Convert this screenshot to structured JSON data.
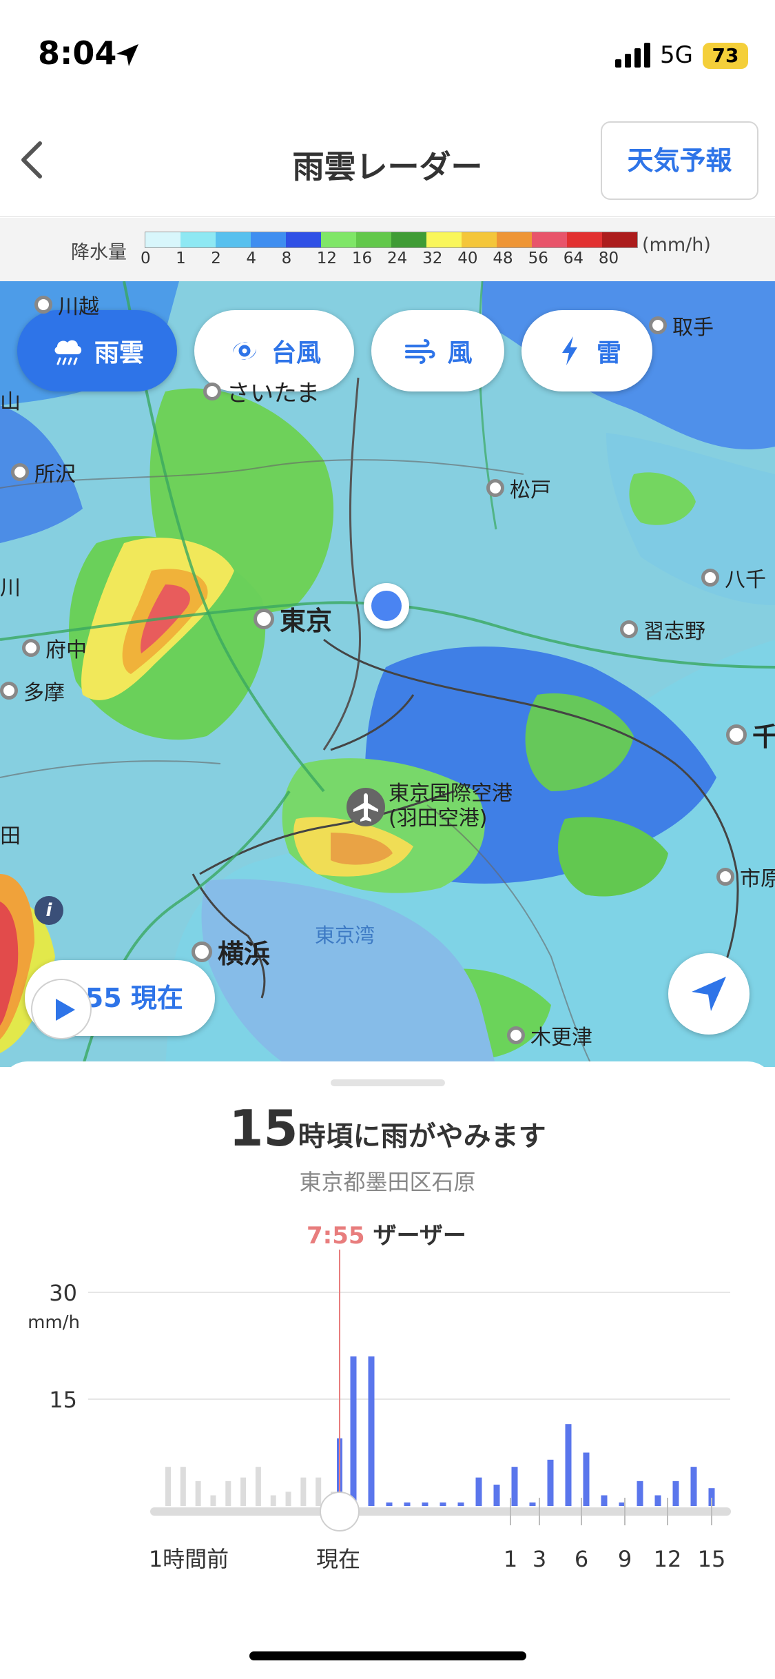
{
  "status": {
    "time": "8:04",
    "network": "5G",
    "battery": "73"
  },
  "nav": {
    "title": "雨雲レーダー",
    "forecast_button": "天気予報"
  },
  "legend": {
    "title": "降水量",
    "unit": "(mm/h)",
    "ticks": [
      "0",
      "1",
      "2",
      "4",
      "8",
      "12",
      "16",
      "24",
      "32",
      "40",
      "48",
      "56",
      "64",
      "80"
    ],
    "colors": [
      "#d8f6fb",
      "#8ee8f3",
      "#57c0ee",
      "#3f8ef0",
      "#2f50e6",
      "#7fe667",
      "#62c84a",
      "#3f9c35",
      "#f9f65a",
      "#f4c63a",
      "#ee9535",
      "#e8546a",
      "#e23030",
      "#ac1c1c"
    ]
  },
  "layers": [
    {
      "label": "雨雲",
      "icon": "rain-cloud-icon",
      "active": true
    },
    {
      "label": "台風",
      "icon": "typhoon-icon",
      "active": false
    },
    {
      "label": "風",
      "icon": "wind-icon",
      "active": false
    },
    {
      "label": "雷",
      "icon": "lightning-icon",
      "active": false
    }
  ],
  "map": {
    "places": {
      "kawagoe": "川越",
      "toride": "取手",
      "saitama": "さいたま",
      "tokorozawa": "所沢",
      "matsudo": "松戸",
      "yachiyo": "八千",
      "narashino": "習志野",
      "tokyo": "東京",
      "fuchu": "府中",
      "tama": "多摩",
      "chiba": "千",
      "airport": "東京国際空港\n(羽田空港)",
      "ichihara": "市原",
      "yokohama": "横浜",
      "kisarazu": "木更津",
      "bay": "東京湾",
      "edge_yama": "山",
      "edge_ka": "川",
      "edge_ta": "田"
    },
    "time_pill": "7:55 現在"
  },
  "sheet": {
    "hour": "15",
    "message": "時頃に雨がやみます",
    "location": "東京都墨田区石原",
    "now_time": "7:55",
    "now_desc": "ザーザー"
  },
  "chart_data": {
    "type": "bar",
    "unit": "mm/h",
    "y_ticks": [
      "30",
      "15"
    ],
    "ylim": [
      0,
      30
    ],
    "x_labels": [
      "1時間前",
      "現在",
      "1",
      "3",
      "6",
      "9",
      "12",
      "15"
    ],
    "past_values": [
      5.5,
      5.5,
      3.5,
      1.5,
      3.5,
      4,
      5.5,
      1.5,
      2,
      4,
      4,
      2
    ],
    "current_value": 9.5,
    "future_values": [
      21,
      21,
      0.5,
      0.5,
      0.5,
      0.5,
      0.5,
      4,
      3,
      5.5,
      0.5,
      6.5,
      11.5,
      7.5,
      1.5,
      0.5,
      3.5,
      1.5,
      3.5,
      5.5,
      2.5
    ],
    "colors": {
      "past": "#dcdcdc",
      "future": "#5a76ec",
      "now_line": "#e87d7d"
    }
  }
}
